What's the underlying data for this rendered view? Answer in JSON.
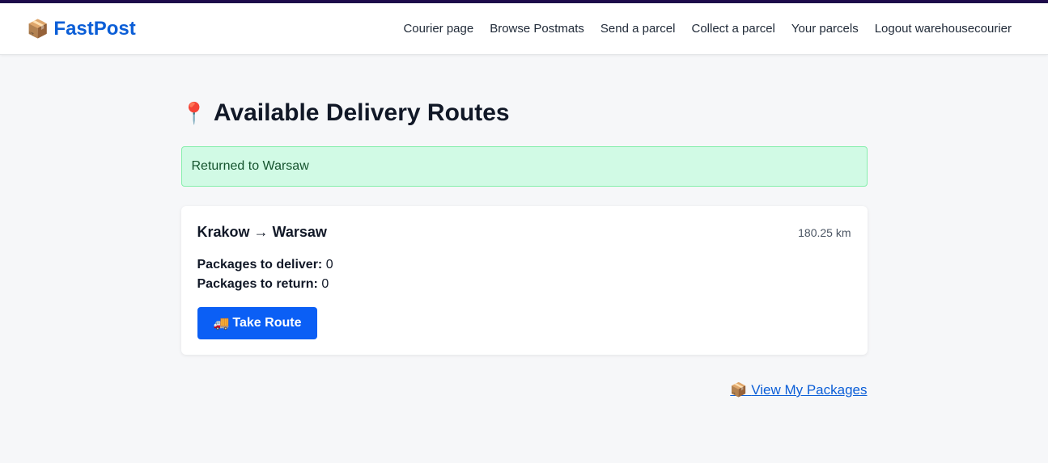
{
  "brand": {
    "icon": "📦",
    "name": "FastPost"
  },
  "nav": {
    "items": [
      {
        "label": "Courier page"
      },
      {
        "label": "Browse Postmats"
      },
      {
        "label": "Send a parcel"
      },
      {
        "label": "Collect a parcel"
      },
      {
        "label": "Your parcels"
      },
      {
        "label": "Logout warehousecourier"
      }
    ]
  },
  "page": {
    "title_icon": "📍",
    "title": "Available Delivery Routes"
  },
  "alert": {
    "message": "Returned to Warsaw"
  },
  "route": {
    "title": "Krakow → Warsaw",
    "distance": "180.25 km",
    "deliver_label": "Packages to deliver:",
    "deliver_count": "0",
    "return_label": "Packages to return:",
    "return_count": "0",
    "button_icon": "🚚",
    "button_label": "Take Route"
  },
  "footer": {
    "link_icon": "📦",
    "link_label": "View My Packages"
  },
  "colors": {
    "accent": "#0b5ed7",
    "button": "#0b5ff5",
    "success_bg": "#d1fae5",
    "topline": "#1e0b4b"
  }
}
